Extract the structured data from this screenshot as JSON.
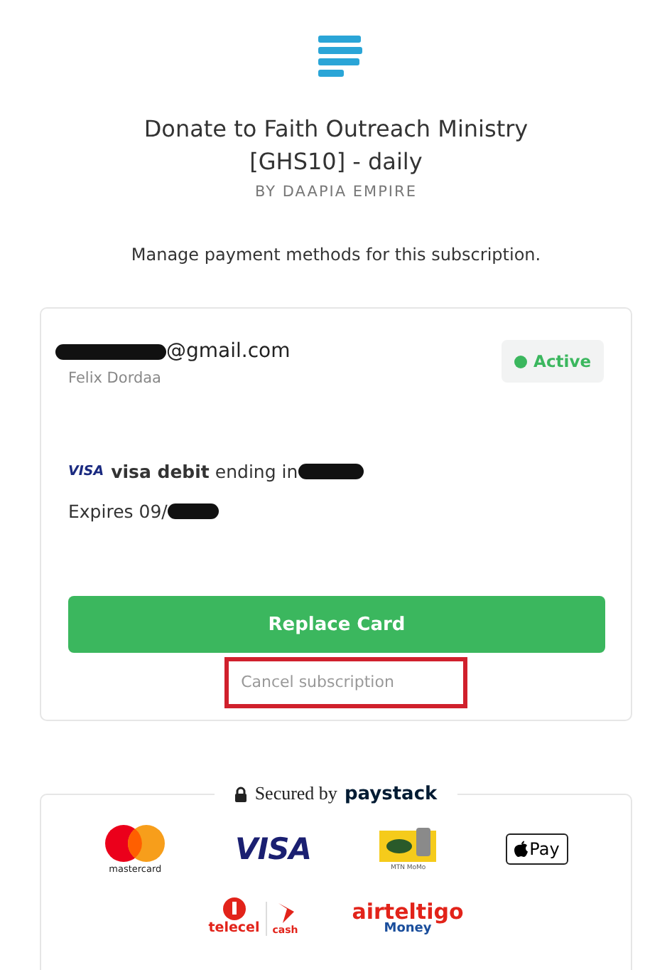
{
  "header": {
    "title": "Donate to Faith Outreach Ministry [GHS10] - daily",
    "byline": "BY DAAPIA EMPIRE",
    "subtitle": "Manage payment methods for this subscription."
  },
  "subscriber": {
    "email": "@gmail.com",
    "email_redacted": true,
    "name": "Felix Dordaa",
    "status": {
      "label": "Active",
      "active": true
    }
  },
  "card": {
    "brand": "VISA",
    "type": "visa debit",
    "ending": "ending in",
    "ending_redacted": true,
    "expires": "Expires 09/",
    "expires_redacted": true
  },
  "replace_button": "Replace Card",
  "cancel_link": {
    "text": "Cancel subscription",
    "highlighted": true
  },
  "security": {
    "prefix": "Secured by",
    "brand": "paystack"
  },
  "payment_methods": [
    {
      "kind": "mastercard",
      "labels": [
        "mastercard"
      ]
    },
    {
      "kind": "visa",
      "labels": [
        "VISA"
      ]
    },
    {
      "kind": "mtn",
      "labels": [
        "MTN MoMo"
      ]
    },
    {
      "kind": "applepay",
      "labels": [
        "Pay"
      ]
    },
    {
      "kind": "telecel",
      "labels": [
        "telecel",
        "cash"
      ]
    },
    {
      "kind": "airteltigo",
      "labels": [
        "airteltigo",
        "Money"
      ]
    }
  ]
}
